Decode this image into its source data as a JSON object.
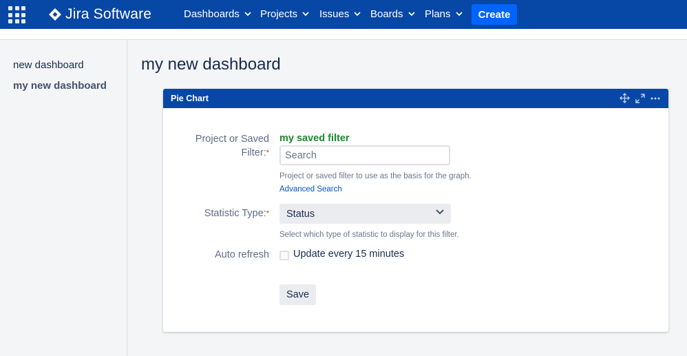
{
  "topnav": {
    "app_name": "Jira Software",
    "menus": [
      {
        "label": "Dashboards"
      },
      {
        "label": "Projects"
      },
      {
        "label": "Issues"
      },
      {
        "label": "Boards"
      },
      {
        "label": "Plans"
      }
    ],
    "create_label": "Create",
    "brand_color": "#0747a6",
    "create_color": "#0065ff"
  },
  "sidebar": {
    "items": [
      {
        "label": "new dashboard",
        "active": false
      },
      {
        "label": "my new dashboard",
        "active": true
      }
    ]
  },
  "page": {
    "title": "my new dashboard"
  },
  "gadget": {
    "title": "Pie Chart",
    "icons": [
      "move-icon",
      "expand-icon",
      "more-options-icon"
    ],
    "filter_field": {
      "label": "Project or Saved Filter:",
      "required_marker": "*",
      "selected_value": "my saved filter",
      "placeholder": "Search",
      "help": "Project or saved filter to use as the basis for the graph.",
      "advanced_link": "Advanced Search"
    },
    "statistic_field": {
      "label": "Statistic Type:",
      "required_marker": "*",
      "value": "Status",
      "help": "Select which type of statistic to display for this filter."
    },
    "auto_refresh": {
      "label": "Auto refresh",
      "checkbox_label": "Update every 15 minutes",
      "checked": false
    },
    "save_label": "Save"
  }
}
